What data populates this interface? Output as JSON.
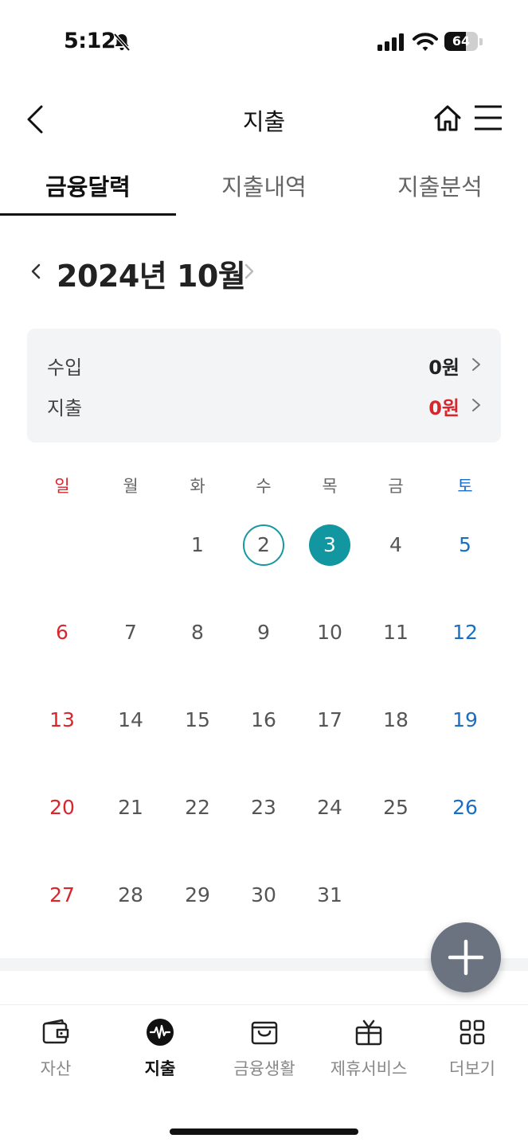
{
  "status_bar": {
    "time": "5:12",
    "battery_level": "64",
    "battery_fraction": 0.64
  },
  "header": {
    "title": "지출",
    "icons": [
      "back-arrow-icon",
      "home-icon",
      "hamburger-menu-icon"
    ]
  },
  "tabs": [
    {
      "label": "금융달력",
      "active": true
    },
    {
      "label": "지출내역",
      "active": false
    },
    {
      "label": "지출분석",
      "active": false
    }
  ],
  "month_nav": {
    "label": "2024년 10월"
  },
  "summary": {
    "income_label": "수입",
    "income_value": "0원",
    "expense_label": "지출",
    "expense_value": "0원"
  },
  "calendar": {
    "weekdays": [
      "일",
      "월",
      "화",
      "수",
      "목",
      "금",
      "토"
    ],
    "first_weekday_index": 2,
    "days_in_month": 31,
    "outlined_day": 2,
    "selected_day": 3
  },
  "colors": {
    "accent": "#12969f",
    "sunday": "#d8262c",
    "saturday": "#1a6fc5",
    "fab": "#6b7280"
  },
  "bottom_nav": [
    {
      "label": "자산",
      "icon": "wallet-icon",
      "active": false
    },
    {
      "label": "지출",
      "icon": "pulse-circle-icon",
      "active": true
    },
    {
      "label": "금융생활",
      "icon": "shopping-bag-icon",
      "active": false
    },
    {
      "label": "제휴서비스",
      "icon": "gift-icon",
      "active": false
    },
    {
      "label": "더보기",
      "icon": "grid-icon",
      "active": false
    }
  ]
}
